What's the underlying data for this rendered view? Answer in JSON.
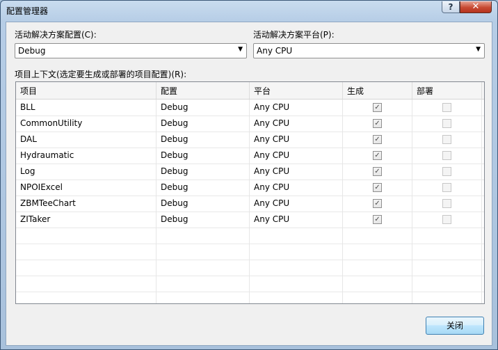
{
  "window": {
    "title": "配置管理器"
  },
  "titlebar": {
    "help_glyph": "?",
    "close_glyph": "✕"
  },
  "active_config": {
    "label": "活动解决方案配置(C):",
    "value": "Debug"
  },
  "active_platform": {
    "label": "活动解决方案平台(P):",
    "value": "Any CPU"
  },
  "context_label": "项目上下文(选定要生成或部署的项目配置)(R):",
  "grid": {
    "headers": [
      "项目",
      "配置",
      "平台",
      "生成",
      "部署"
    ],
    "rows": [
      {
        "project": "BLL",
        "config": "Debug",
        "platform": "Any CPU",
        "build": true,
        "deploy": false
      },
      {
        "project": "CommonUtility",
        "config": "Debug",
        "platform": "Any CPU",
        "build": true,
        "deploy": false
      },
      {
        "project": "DAL",
        "config": "Debug",
        "platform": "Any CPU",
        "build": true,
        "deploy": false
      },
      {
        "project": "Hydraumatic",
        "config": "Debug",
        "platform": "Any CPU",
        "build": true,
        "deploy": false
      },
      {
        "project": "Log",
        "config": "Debug",
        "platform": "Any CPU",
        "build": true,
        "deploy": false
      },
      {
        "project": "NPOIExcel",
        "config": "Debug",
        "platform": "Any CPU",
        "build": true,
        "deploy": false
      },
      {
        "project": "ZBMTeeChart",
        "config": "Debug",
        "platform": "Any CPU",
        "build": true,
        "deploy": false
      },
      {
        "project": "ZITaker",
        "config": "Debug",
        "platform": "Any CPU",
        "build": true,
        "deploy": false,
        "selected": true
      }
    ],
    "empty_rows": 5
  },
  "buttons": {
    "close_label": "关闭"
  },
  "icons": {
    "dropdown_arrow": "chevron-down-icon",
    "check": "checkmark-icon"
  }
}
